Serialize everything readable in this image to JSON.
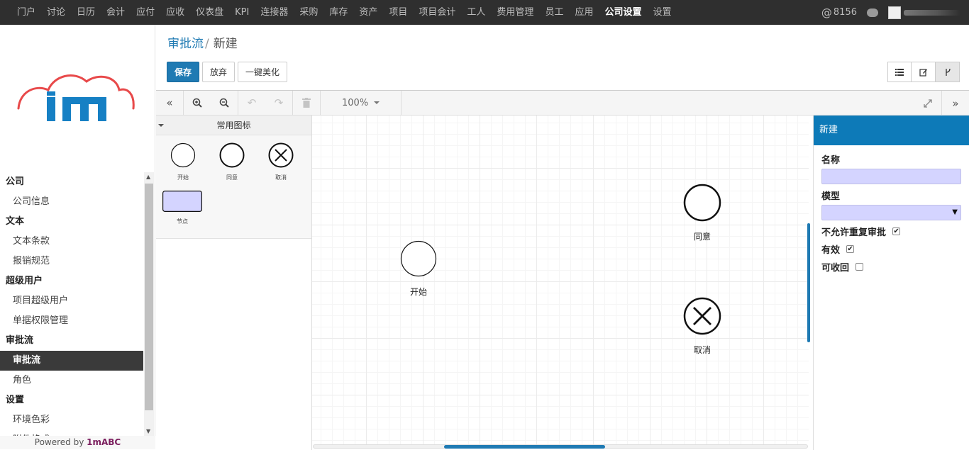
{
  "nav": {
    "items": [
      "门户",
      "讨论",
      "日历",
      "会计",
      "应付",
      "应收",
      "仪表盘",
      "KPI",
      "连接器",
      "采购",
      "库存",
      "资产",
      "项目",
      "项目会计",
      "工人",
      "费用管理",
      "员工",
      "应用",
      "公司设置",
      "设置"
    ],
    "active_index": 18,
    "mention_count": "8156",
    "icons": {
      "mention": "at-icon",
      "chat": "chat-icon",
      "user": "avatar"
    }
  },
  "sidebar": {
    "groups": [
      {
        "title": "公司",
        "items": [
          "公司信息"
        ]
      },
      {
        "title": "文本",
        "items": [
          "文本条款",
          "报销规范"
        ]
      },
      {
        "title": "超级用户",
        "items": [
          "项目超级用户",
          "单据权限管理"
        ]
      },
      {
        "title": "审批流",
        "items": [
          "审批流",
          "角色"
        ]
      },
      {
        "title": "设置",
        "items": [
          "环境色彩",
          "附件格式"
        ]
      }
    ],
    "active_item": "审批流",
    "powered_prefix": "Powered by ",
    "powered_brand": "1mABC",
    "logo_text": "1m",
    "colors": {
      "logo_blue": "#1680c4",
      "logo_cloud": "#e8494a",
      "active_bg": "#3a3a3a"
    }
  },
  "breadcrumb": {
    "parent": "审批流",
    "sep": "/",
    "current": "新建"
  },
  "actions": {
    "save": "保存",
    "discard": "放弃",
    "beautify": "一键美化"
  },
  "view_switch": {
    "icons": [
      "list-icon",
      "edit-icon",
      "flow-icon"
    ],
    "active": 2
  },
  "toolbar": {
    "zoom": "100%",
    "icons": [
      "collapse-left-icon",
      "zoom-in-icon",
      "zoom-out-icon",
      "undo-icon",
      "redo-icon",
      "trash-icon",
      "fullscreen-icon",
      "collapse-right-icon"
    ]
  },
  "palette": {
    "title": "常用图标",
    "shapes": {
      "start": "开始",
      "agree": "同意",
      "cancel": "取消",
      "node": "节点"
    }
  },
  "canvas": {
    "nodes": {
      "start": "开始",
      "agree": "同意",
      "cancel": "取消"
    }
  },
  "properties": {
    "title": "新建",
    "name_label": "名称",
    "name_value": "",
    "model_label": "模型",
    "model_value": "",
    "no_repeat_label": "不允许重复审批",
    "no_repeat_checked": true,
    "valid_label": "有效",
    "valid_checked": true,
    "recallable_label": "可收回",
    "recallable_checked": false,
    "colors": {
      "header": "#0d7ab8",
      "input_bg": "#d4d4ff"
    }
  },
  "colors": {
    "topbar": "#2f2f2f",
    "primary": "#1f7ab3"
  }
}
